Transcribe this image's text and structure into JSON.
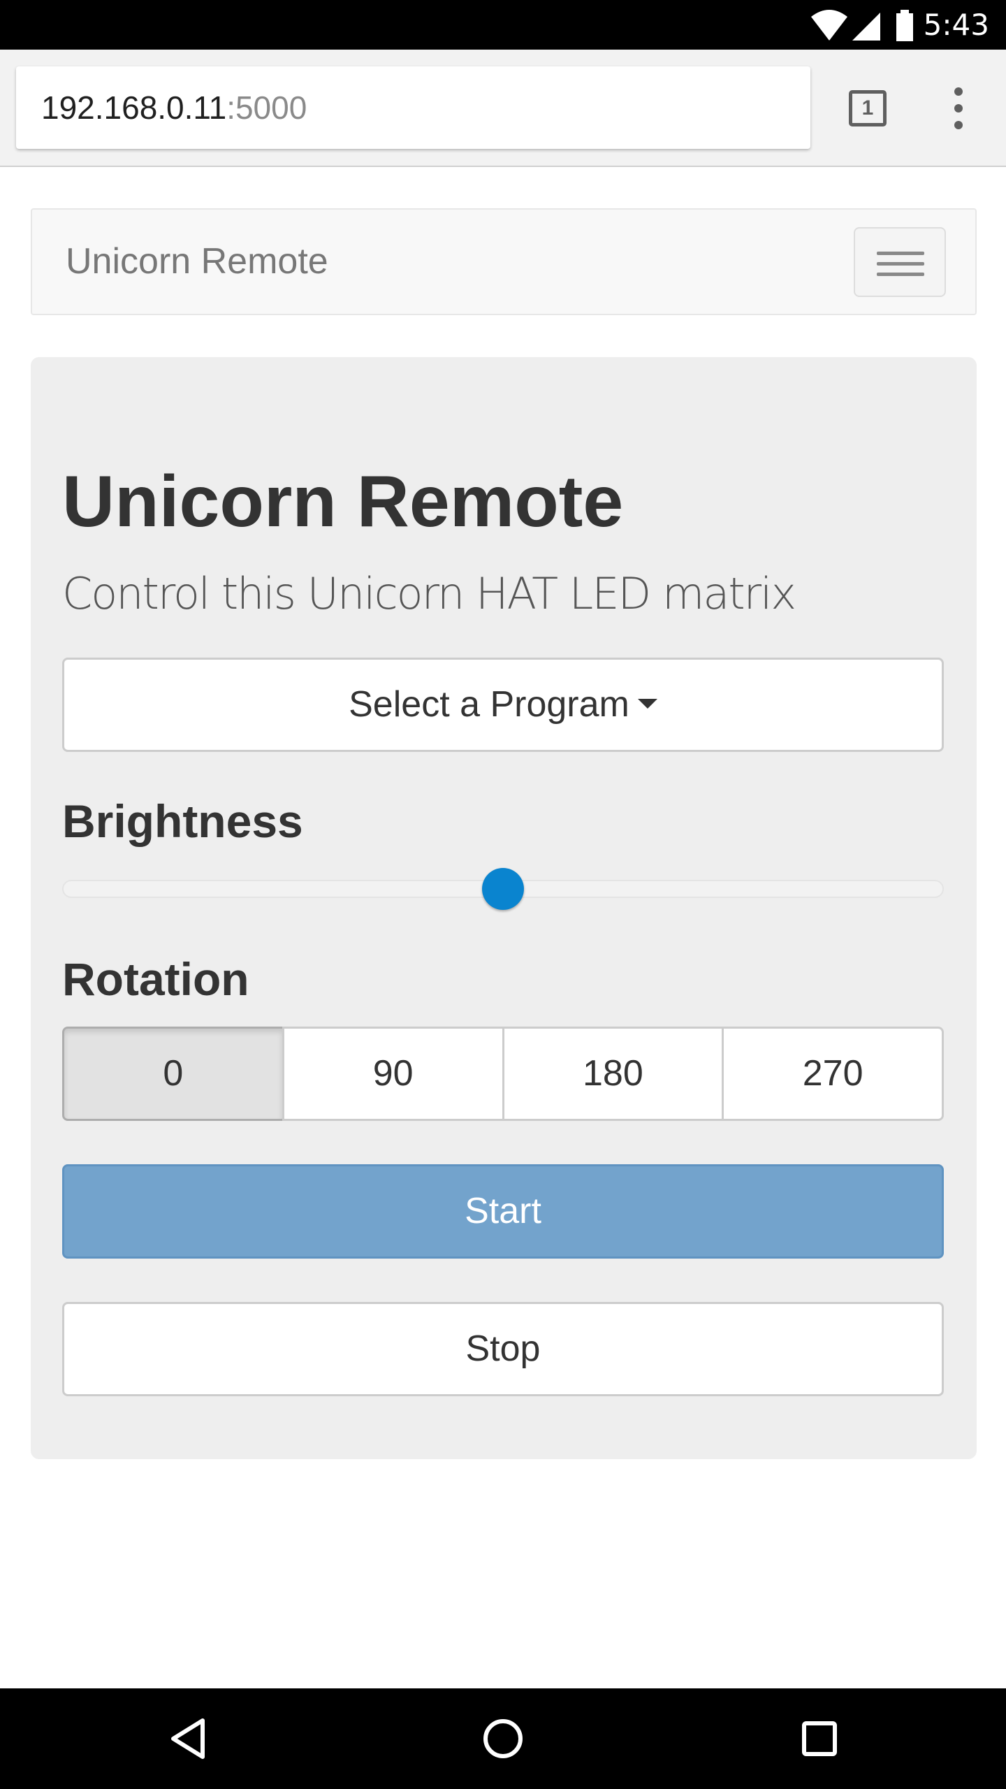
{
  "status_bar": {
    "time": "5:43",
    "icons": [
      "wifi-icon",
      "signal-icon",
      "battery-icon"
    ]
  },
  "browser": {
    "url_host": "192.168.0.11",
    "url_port": ":5000",
    "tab_count": "1"
  },
  "navbar": {
    "brand": "Unicorn Remote"
  },
  "main": {
    "title": "Unicorn Remote",
    "lead": "Control this Unicorn HAT LED matrix",
    "program_select": "Select a Program",
    "brightness_label": "Brightness",
    "brightness_value": 0.5,
    "rotation_label": "Rotation",
    "rotation_options": [
      "0",
      "90",
      "180",
      "270"
    ],
    "rotation_selected": "0",
    "start_label": "Start",
    "stop_label": "Stop"
  },
  "colors": {
    "primary_button": "#73a3cc",
    "slider_thumb": "#0a84cf",
    "jumbotron": "#eeeeee"
  }
}
